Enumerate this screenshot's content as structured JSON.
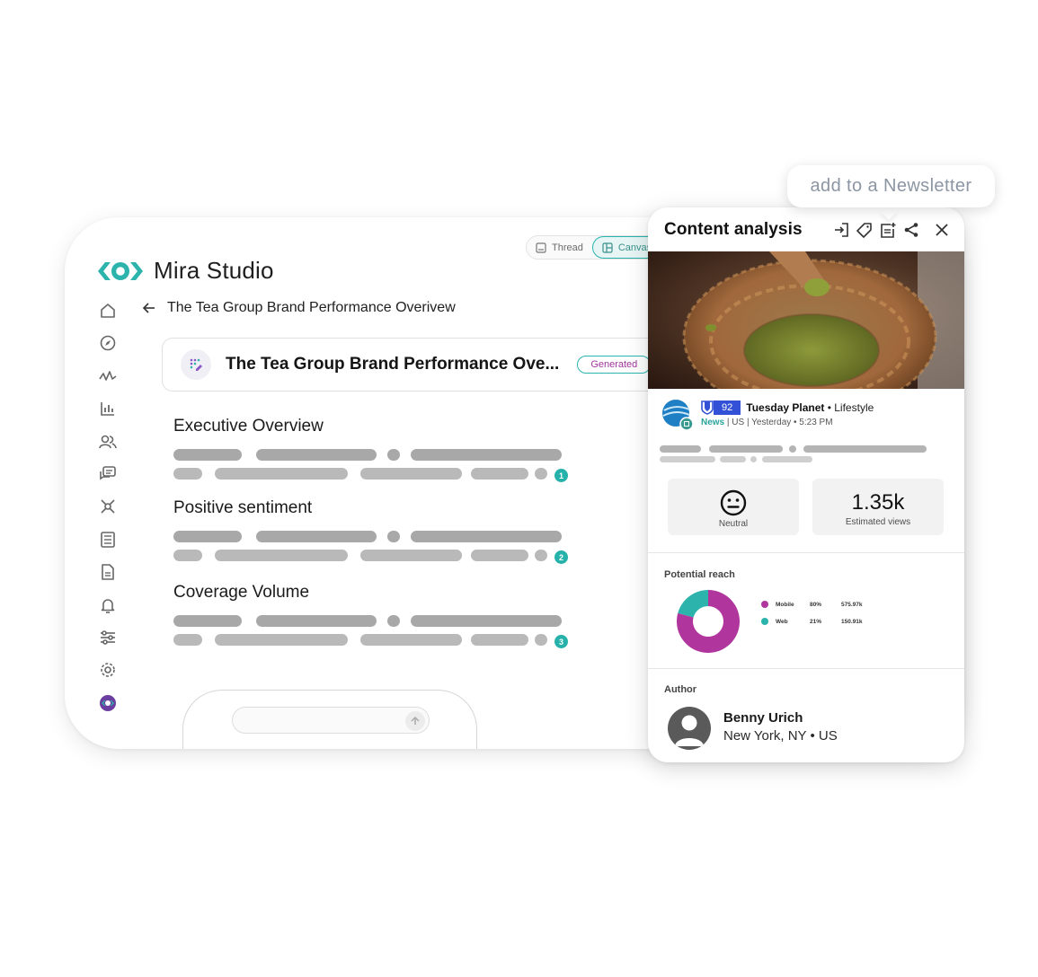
{
  "brand": {
    "name": "Mira Studio"
  },
  "view_toggle": {
    "options": [
      "Thread",
      "Canvas"
    ],
    "active": "Canvas"
  },
  "side_nav": [
    {
      "icon": "home-icon"
    },
    {
      "icon": "compass-icon"
    },
    {
      "icon": "pulse-icon"
    },
    {
      "icon": "bar-chart-icon"
    },
    {
      "icon": "people-icon"
    },
    {
      "icon": "chat-icon"
    },
    {
      "icon": "network-icon"
    },
    {
      "icon": "list-document-icon"
    },
    {
      "icon": "report-icon"
    },
    {
      "icon": "bell-icon"
    },
    {
      "icon": "sliders-icon"
    },
    {
      "icon": "gear-icon"
    },
    {
      "icon": "mira-logo-icon"
    }
  ],
  "breadcrumb": {
    "title": "The Tea Group Brand Performance Overivew"
  },
  "report": {
    "title": "The Tea Group Brand Performance Ove...",
    "badge": "Generated"
  },
  "sections": [
    {
      "title": "Executive Overview",
      "badge": "1"
    },
    {
      "title": "Positive sentiment",
      "badge": "2"
    },
    {
      "title": "Coverage Volume",
      "badge": "3"
    }
  ],
  "tooltip": {
    "text": "add to a Newsletter"
  },
  "panel": {
    "title": "Content analysis",
    "actions": [
      "export-icon",
      "tag-icon",
      "newsletter-icon",
      "share-icon",
      "close-icon"
    ],
    "source": {
      "score": "92",
      "outlet": "Tuesday Planet",
      "category": " • Lifestyle",
      "type": "News",
      "meta": " | US | Yesterday • 5:23 PM"
    },
    "sentiment": {
      "label": "Neutral"
    },
    "views": {
      "value": "1.35k",
      "label": "Estimated views"
    },
    "reach": {
      "title": "Potential reach",
      "items": [
        {
          "name": "Mobile",
          "pct": "80%",
          "value": "575.97k",
          "color": "#b0369e"
        },
        {
          "name": "Web",
          "pct": "21%",
          "value": "150.91k",
          "color": "#2bb3ac"
        }
      ]
    },
    "author": {
      "label": "Author",
      "name": "Benny Urich",
      "location": "New York, NY • US"
    }
  },
  "colors": {
    "accent": "#2bb3ac",
    "magenta": "#b0369e",
    "score_blue": "#3251d6"
  }
}
